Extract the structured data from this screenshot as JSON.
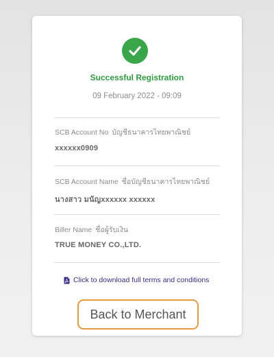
{
  "status": {
    "icon": "check-circle-icon",
    "title": "Successful Registration",
    "date": "09 February 2022 - 09:09",
    "color": "#2e9a3f"
  },
  "fields": [
    {
      "label_en": "SCB Account No",
      "label_th": "บัญชีธนาคารไทยพาณิชย์",
      "value": "xxxxxx0909"
    },
    {
      "label_en": "SCB Account Name",
      "label_th": "ชื่อบัญชีธนาคารไทยพาณิชย์",
      "value": "นางสาว มนัญxxxxxx  xxxxxx"
    },
    {
      "label_en": "Biller Name",
      "label_th": "ชื่อผู้รับเงิน",
      "value": "TRUE MONEY CO.,LTD."
    }
  ],
  "download": {
    "icon": "pdf-file-icon",
    "label": "Click to download full terms and conditions",
    "color": "#3b2a8a"
  },
  "back_button": {
    "label": "Back to Merchant",
    "border_color": "#e89a3c"
  }
}
